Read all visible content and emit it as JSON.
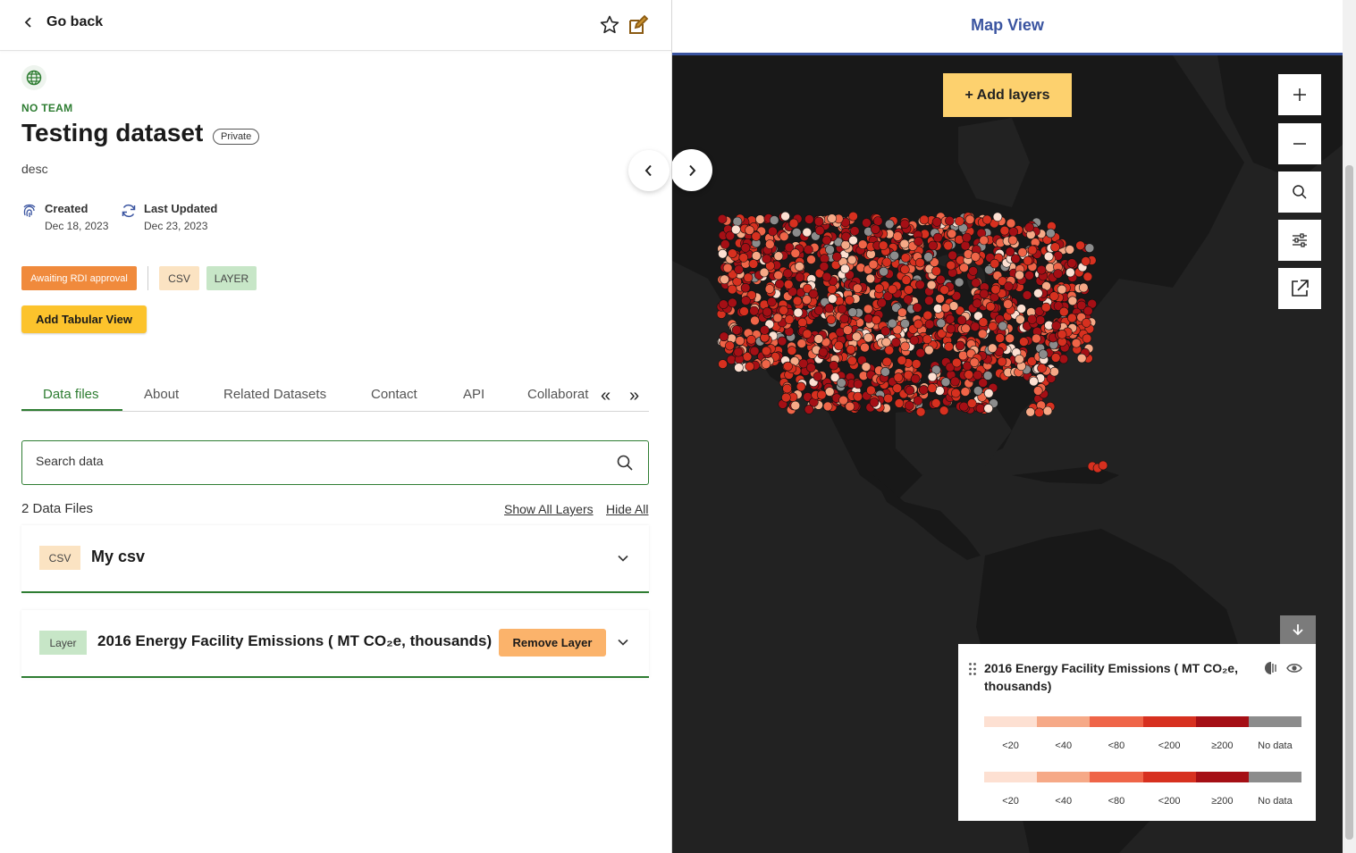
{
  "header": {
    "back_label": "Go back"
  },
  "dataset": {
    "team": "NO TEAM",
    "title": "Testing dataset",
    "visibility": "Private",
    "description": "desc",
    "created_label": "Created",
    "created_date": "Dec 18, 2023",
    "updated_label": "Last Updated",
    "updated_date": "Dec 23, 2023",
    "status_chip": "Awaiting RDI approval",
    "type_chips": [
      "CSV",
      "LAYER"
    ],
    "add_tabular_label": "Add Tabular View"
  },
  "tabs": [
    "Data files",
    "About",
    "Related Datasets",
    "Contact",
    "API",
    "Collaborat"
  ],
  "tab_nav": {
    "prev": "«",
    "next": "»"
  },
  "search": {
    "placeholder": "Search data"
  },
  "files_header": {
    "count": "2 Data Files",
    "show_all": "Show All Layers",
    "hide_all": "Hide All"
  },
  "files": [
    {
      "badge": "CSV",
      "name": "My csv"
    },
    {
      "badge": "Layer",
      "name": "2016 Energy Facility Emissions ( MT CO₂e, thousands)",
      "action": "Remove Layer"
    }
  ],
  "map": {
    "title": "Map View",
    "add_layers": "+ Add layers",
    "legend": {
      "title": "2016 Energy Facility Emissions ( MT CO₂e, thousands)",
      "bins": [
        {
          "label": "<20",
          "color": "#fde0d2"
        },
        {
          "label": "<40",
          "color": "#f6a987"
        },
        {
          "label": "<80",
          "color": "#ef6548"
        },
        {
          "label": "<200",
          "color": "#d7301f"
        },
        {
          "label": "≥200",
          "color": "#a50f15"
        },
        {
          "label": "No data",
          "color": "#8c8c8c"
        }
      ]
    }
  },
  "colors": {
    "accent_green": "#2e7d32",
    "map_blue": "#3a54a0",
    "yellow": "#fcc32c",
    "status_orange": "#f08a3c"
  }
}
